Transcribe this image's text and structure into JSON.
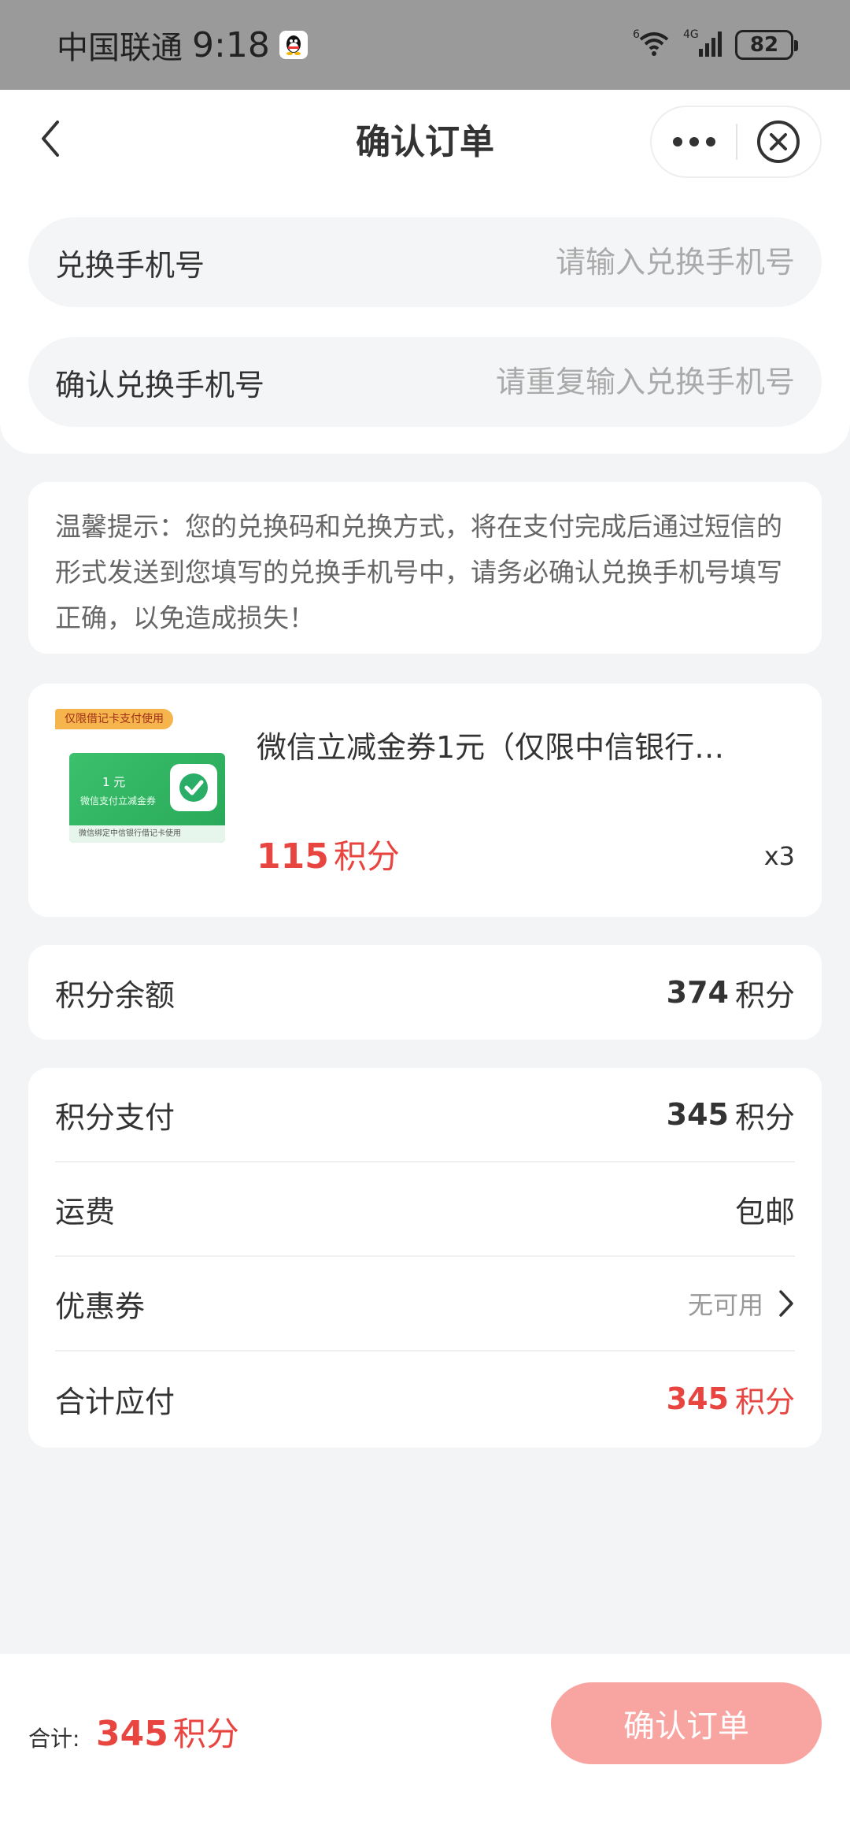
{
  "status_bar": {
    "carrier": "中国联通",
    "time": "9:18",
    "wifi_label": "6",
    "network": "4G",
    "battery": "82"
  },
  "header": {
    "title": "确认订单"
  },
  "form": {
    "phone": {
      "label": "兑换手机号",
      "placeholder": "请输入兑换手机号"
    },
    "confirm_phone": {
      "label": "确认兑换手机号",
      "placeholder": "请重复输入兑换手机号"
    }
  },
  "tip": {
    "text": "温馨提示：您的兑换码和兑换方式，将在支付完成后通过短信的形式发送到您填写的兑换手机号中，请务必确认兑换手机号填写正确，以免造成损失！"
  },
  "product": {
    "tag": "仅限借记卡支付使用",
    "coupon_amount": "1 元",
    "coupon_subtitle": "微信支付立减金券",
    "coupon_footer": "微信绑定中信银行借记卡使用",
    "name": "微信立减金券1元（仅限中信银行…",
    "price_value": "115",
    "price_unit": "积分",
    "quantity": "x3"
  },
  "balance": {
    "label": "积分余额",
    "value": "374",
    "unit": "积分"
  },
  "summary": {
    "points_pay": {
      "label": "积分支付",
      "value": "345",
      "unit": "积分"
    },
    "shipping": {
      "label": "运费",
      "value": "包邮"
    },
    "coupon": {
      "label": "优惠券",
      "value": "无可用"
    },
    "total": {
      "label": "合计应付",
      "value": "345",
      "unit": "积分"
    }
  },
  "bottom_bar": {
    "total_label": "合计:",
    "total_value": "345",
    "total_unit": "积分",
    "submit_label": "确认订单"
  },
  "colors": {
    "accent_red": "#e84540",
    "button_disabled": "#f8a4a1",
    "background": "#f3f4f6"
  }
}
